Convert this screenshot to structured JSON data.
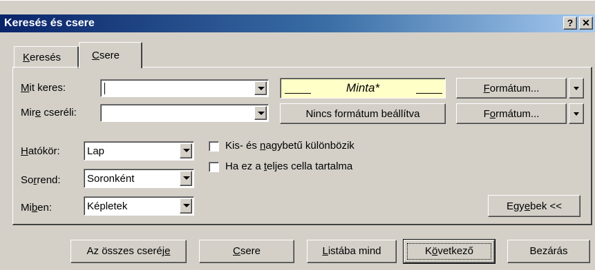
{
  "window": {
    "title": "Keresés és csere",
    "help_button": "?",
    "close_button": "✕"
  },
  "tabs": [
    {
      "pre": "",
      "accel": "K",
      "post": "eresés"
    },
    {
      "pre": "",
      "accel": "C",
      "post": "sere"
    }
  ],
  "find": {
    "label_pre": "",
    "label_accel": "M",
    "label_post": "it keres:",
    "value": ""
  },
  "replace": {
    "label_pre": "Mir",
    "label_accel": "e",
    "label_post": " cseréli:",
    "value": ""
  },
  "preview": {
    "text": "Minta*",
    "no_format": "Nincs formátum beállítva"
  },
  "format_buttons": [
    {
      "pre": "",
      "accel": "F",
      "post": "ormátum..."
    },
    {
      "pre": "F",
      "accel": "o",
      "post": "rmátum..."
    }
  ],
  "options": {
    "within": {
      "label_pre": "",
      "label_accel": "H",
      "label_post": "atókör:",
      "value": "Lap"
    },
    "search": {
      "label_pre": "So",
      "label_accel": "r",
      "label_post": "rend:",
      "value": "Soronként"
    },
    "lookin": {
      "label_pre": "Mi",
      "label_accel": "b",
      "label_post": "en:",
      "value": "Képletek"
    }
  },
  "checkboxes": [
    {
      "pre": "Kis- és ",
      "accel": "n",
      "post": "agybetű különbözik",
      "checked": false
    },
    {
      "pre": "Ha ez a ",
      "accel": "t",
      "post": "eljes cella tartalma",
      "checked": false
    }
  ],
  "more_button": {
    "pre": "Egy",
    "accel": "e",
    "post": "bek <<"
  },
  "footer": {
    "replace_all": {
      "pre": "Az összes cseréj",
      "accel": "e",
      "post": ""
    },
    "replace": {
      "pre": "",
      "accel": "C",
      "post": "sere"
    },
    "find_all": {
      "pre": "",
      "accel": "L",
      "post": "istába mind"
    },
    "find_next": {
      "pre": "K",
      "accel": "ö",
      "post": "vetkező"
    },
    "close": {
      "pre": "Bezárás",
      "accel": "",
      "post": ""
    }
  }
}
